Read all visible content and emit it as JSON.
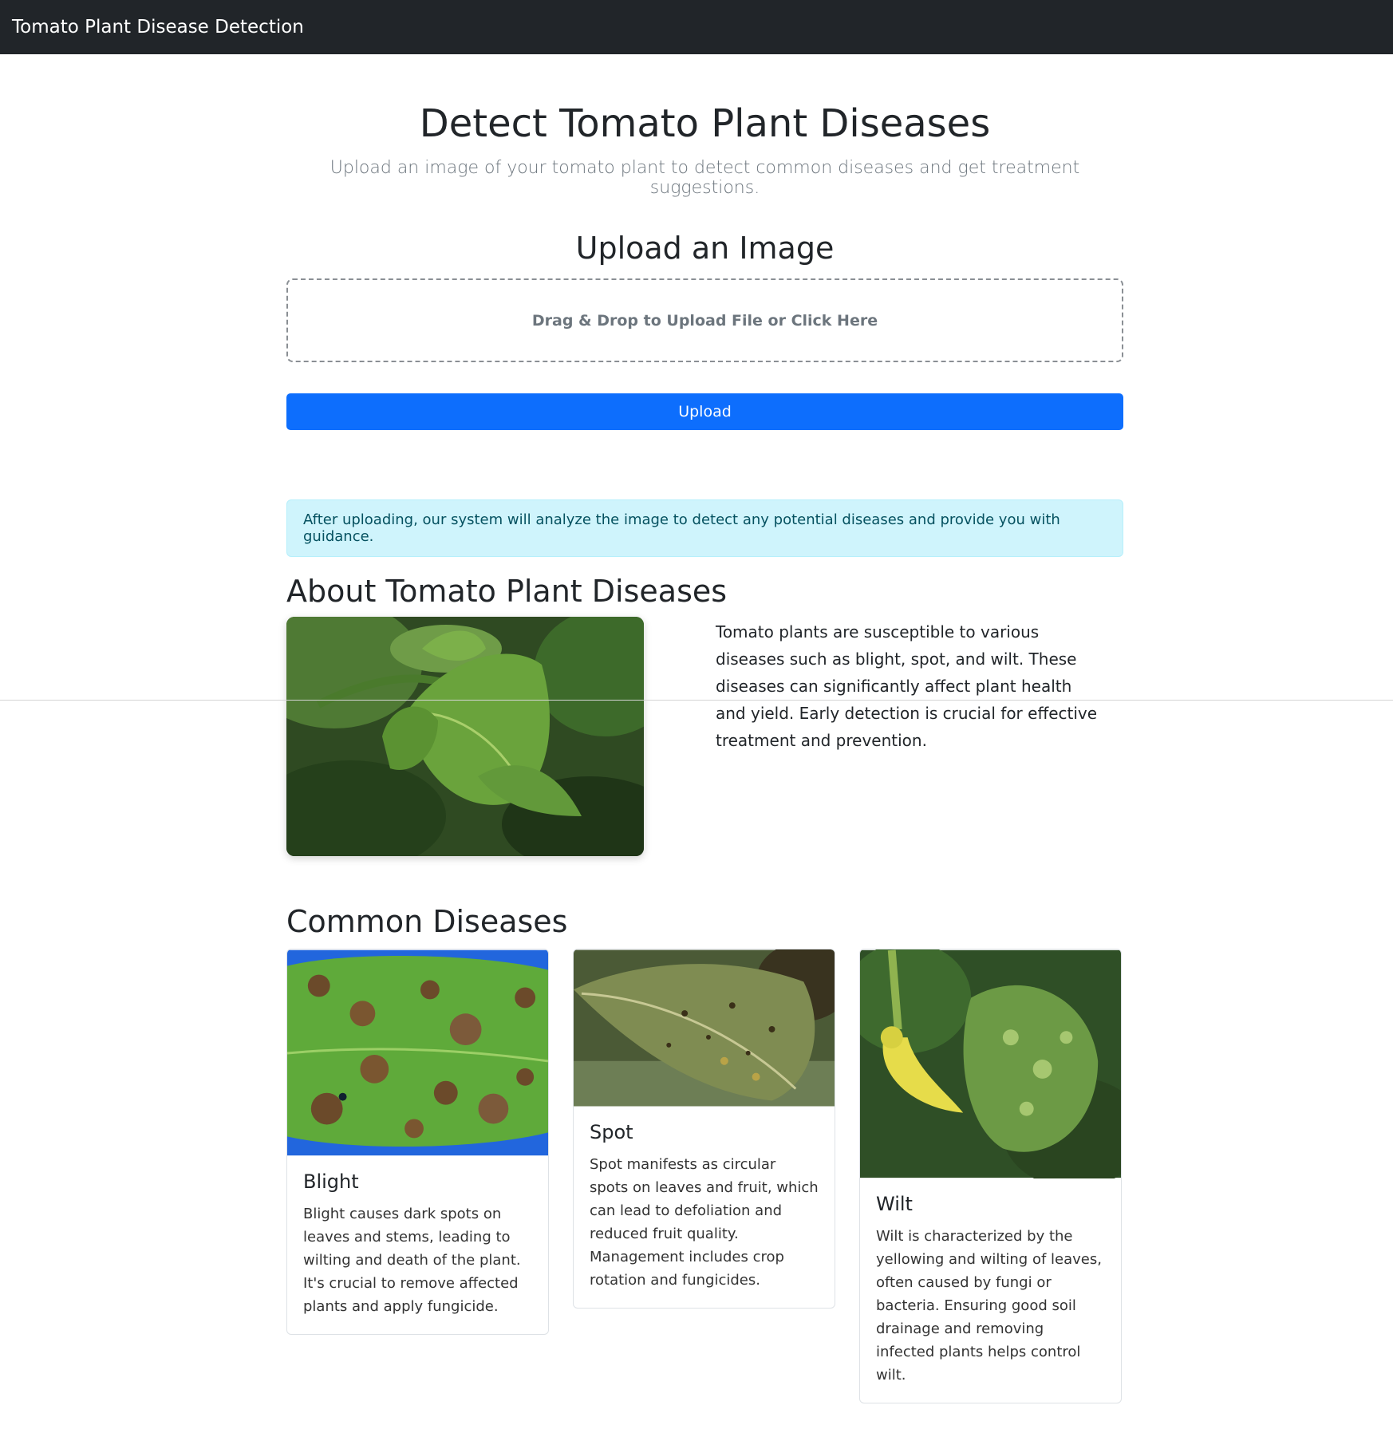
{
  "navbar": {
    "brand": "Tomato Plant Disease Detection"
  },
  "hero": {
    "title": "Detect Tomato Plant Diseases",
    "subtitle": "Upload an image of your tomato plant to detect common diseases and get treatment suggestions."
  },
  "upload": {
    "title": "Upload an Image",
    "dropzone_label": "Drag & Drop to Upload File or Click Here",
    "button_label": "Upload"
  },
  "info_alert": "After uploading, our system will analyze the image to detect any potential diseases and provide you with guidance.",
  "about": {
    "title": "About Tomato Plant Diseases",
    "text": "Tomato plants are susceptible to various diseases such as blight, spot, and wilt. These diseases can significantly affect plant health and yield. Early detection is crucial for effective treatment and prevention."
  },
  "diseases": {
    "title": "Common Diseases",
    "cards": [
      {
        "title": "Blight",
        "text": "Blight causes dark spots on leaves and stems, leading to wilting and death of the plant. It's crucial to remove affected plants and apply fungicide."
      },
      {
        "title": "Spot",
        "text": "Spot manifests as circular spots on leaves and fruit, which can lead to defoliation and reduced fruit quality. Management includes crop rotation and fungicides."
      },
      {
        "title": "Wilt",
        "text": "Wilt is characterized by the yellowing and wilting of leaves, often caused by fungi or bacteria. Ensuring good soil drainage and removing infected plants helps control wilt."
      }
    ]
  },
  "colors": {
    "navbar_bg": "#212529",
    "primary": "#0d6efd",
    "alert_bg": "#cff4fc",
    "alert_text": "#055160",
    "muted": "#6c757d"
  }
}
